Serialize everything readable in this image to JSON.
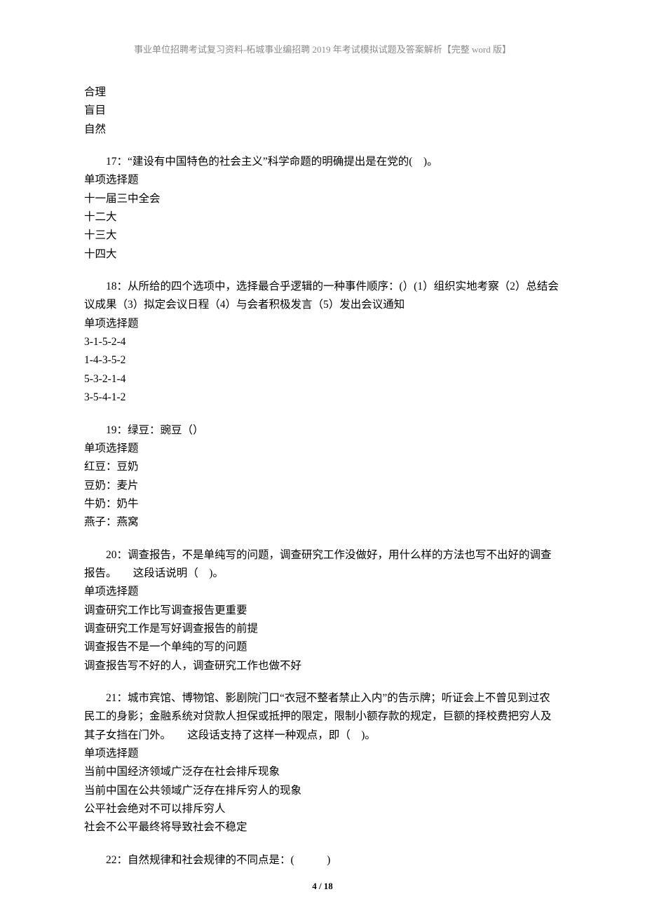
{
  "header": "事业单位招聘考试复习资料-柘城事业编招聘 2019 年考试模拟试题及答案解析【完整 word 版】",
  "prev_options": [
    "合理",
    "盲目",
    "自然"
  ],
  "questions": [
    {
      "num": "17",
      "text": "：“建设有中国特色的社会主义”科学命题的明确提出是在党的(　)。",
      "type": "单项选择题",
      "options": [
        "十一届三中全会",
        "十二大",
        "十三大",
        "十四大"
      ]
    },
    {
      "num": "18",
      "text": "：从所给的四个选项中，选择最合乎逻辑的一种事件顺序：(）(1）组织实地考察（2）总结会议成果（3）拟定会议日程（4）与会者积极发言（5）发出会议通知",
      "type": "单项选择题",
      "options": [
        "3-1-5-2-4",
        "1-4-3-5-2",
        "5-3-2-1-4",
        "3-5-4-1-2"
      ]
    },
    {
      "num": "19",
      "text": "：绿豆：豌豆（）",
      "type": "单项选择题",
      "options": [
        "红豆：豆奶",
        "豆奶：麦片",
        "牛奶：奶牛",
        "燕子：燕窝"
      ]
    },
    {
      "num": "20",
      "text": "：调查报告，不是单纯写的问题，调查研究工作没做好，用什么样的方法也写不出好的调查报告。　　这段话说明（　)。",
      "type": "单项选择题",
      "options": [
        "调查研究工作比写调查报告更重要",
        "调查研究工作是写好调查报告的前提",
        "调查报告不是一个单纯的写的问题",
        "调查报告写不好的人，调查研究工作也做不好"
      ]
    },
    {
      "num": "21",
      "text": "：城市宾馆、博物馆、影剧院门口“衣冠不整者禁止入内”的告示牌；听证会上不曾见到过农民工的身影；金融系统对贷款人担保或抵押的限定，限制小额存款的规定，巨额的择校费把穷人及其子女挡在门外。　　这段话支持了这样一种观点，即（　)。",
      "type": "单项选择题",
      "options": [
        "当前中国经济领域广泛存在社会排斥现象",
        "当前中国在公共领域广泛存在排斥穷人的现象",
        "公平社会绝对不可以排斥穷人",
        "社会不公平最终将导致社会不稳定"
      ]
    },
    {
      "num": "22",
      "text": "：自然规律和社会规律的不同点是：(　　　)",
      "type": "",
      "options": []
    }
  ],
  "footer_page": "4",
  "footer_total": " / 18"
}
